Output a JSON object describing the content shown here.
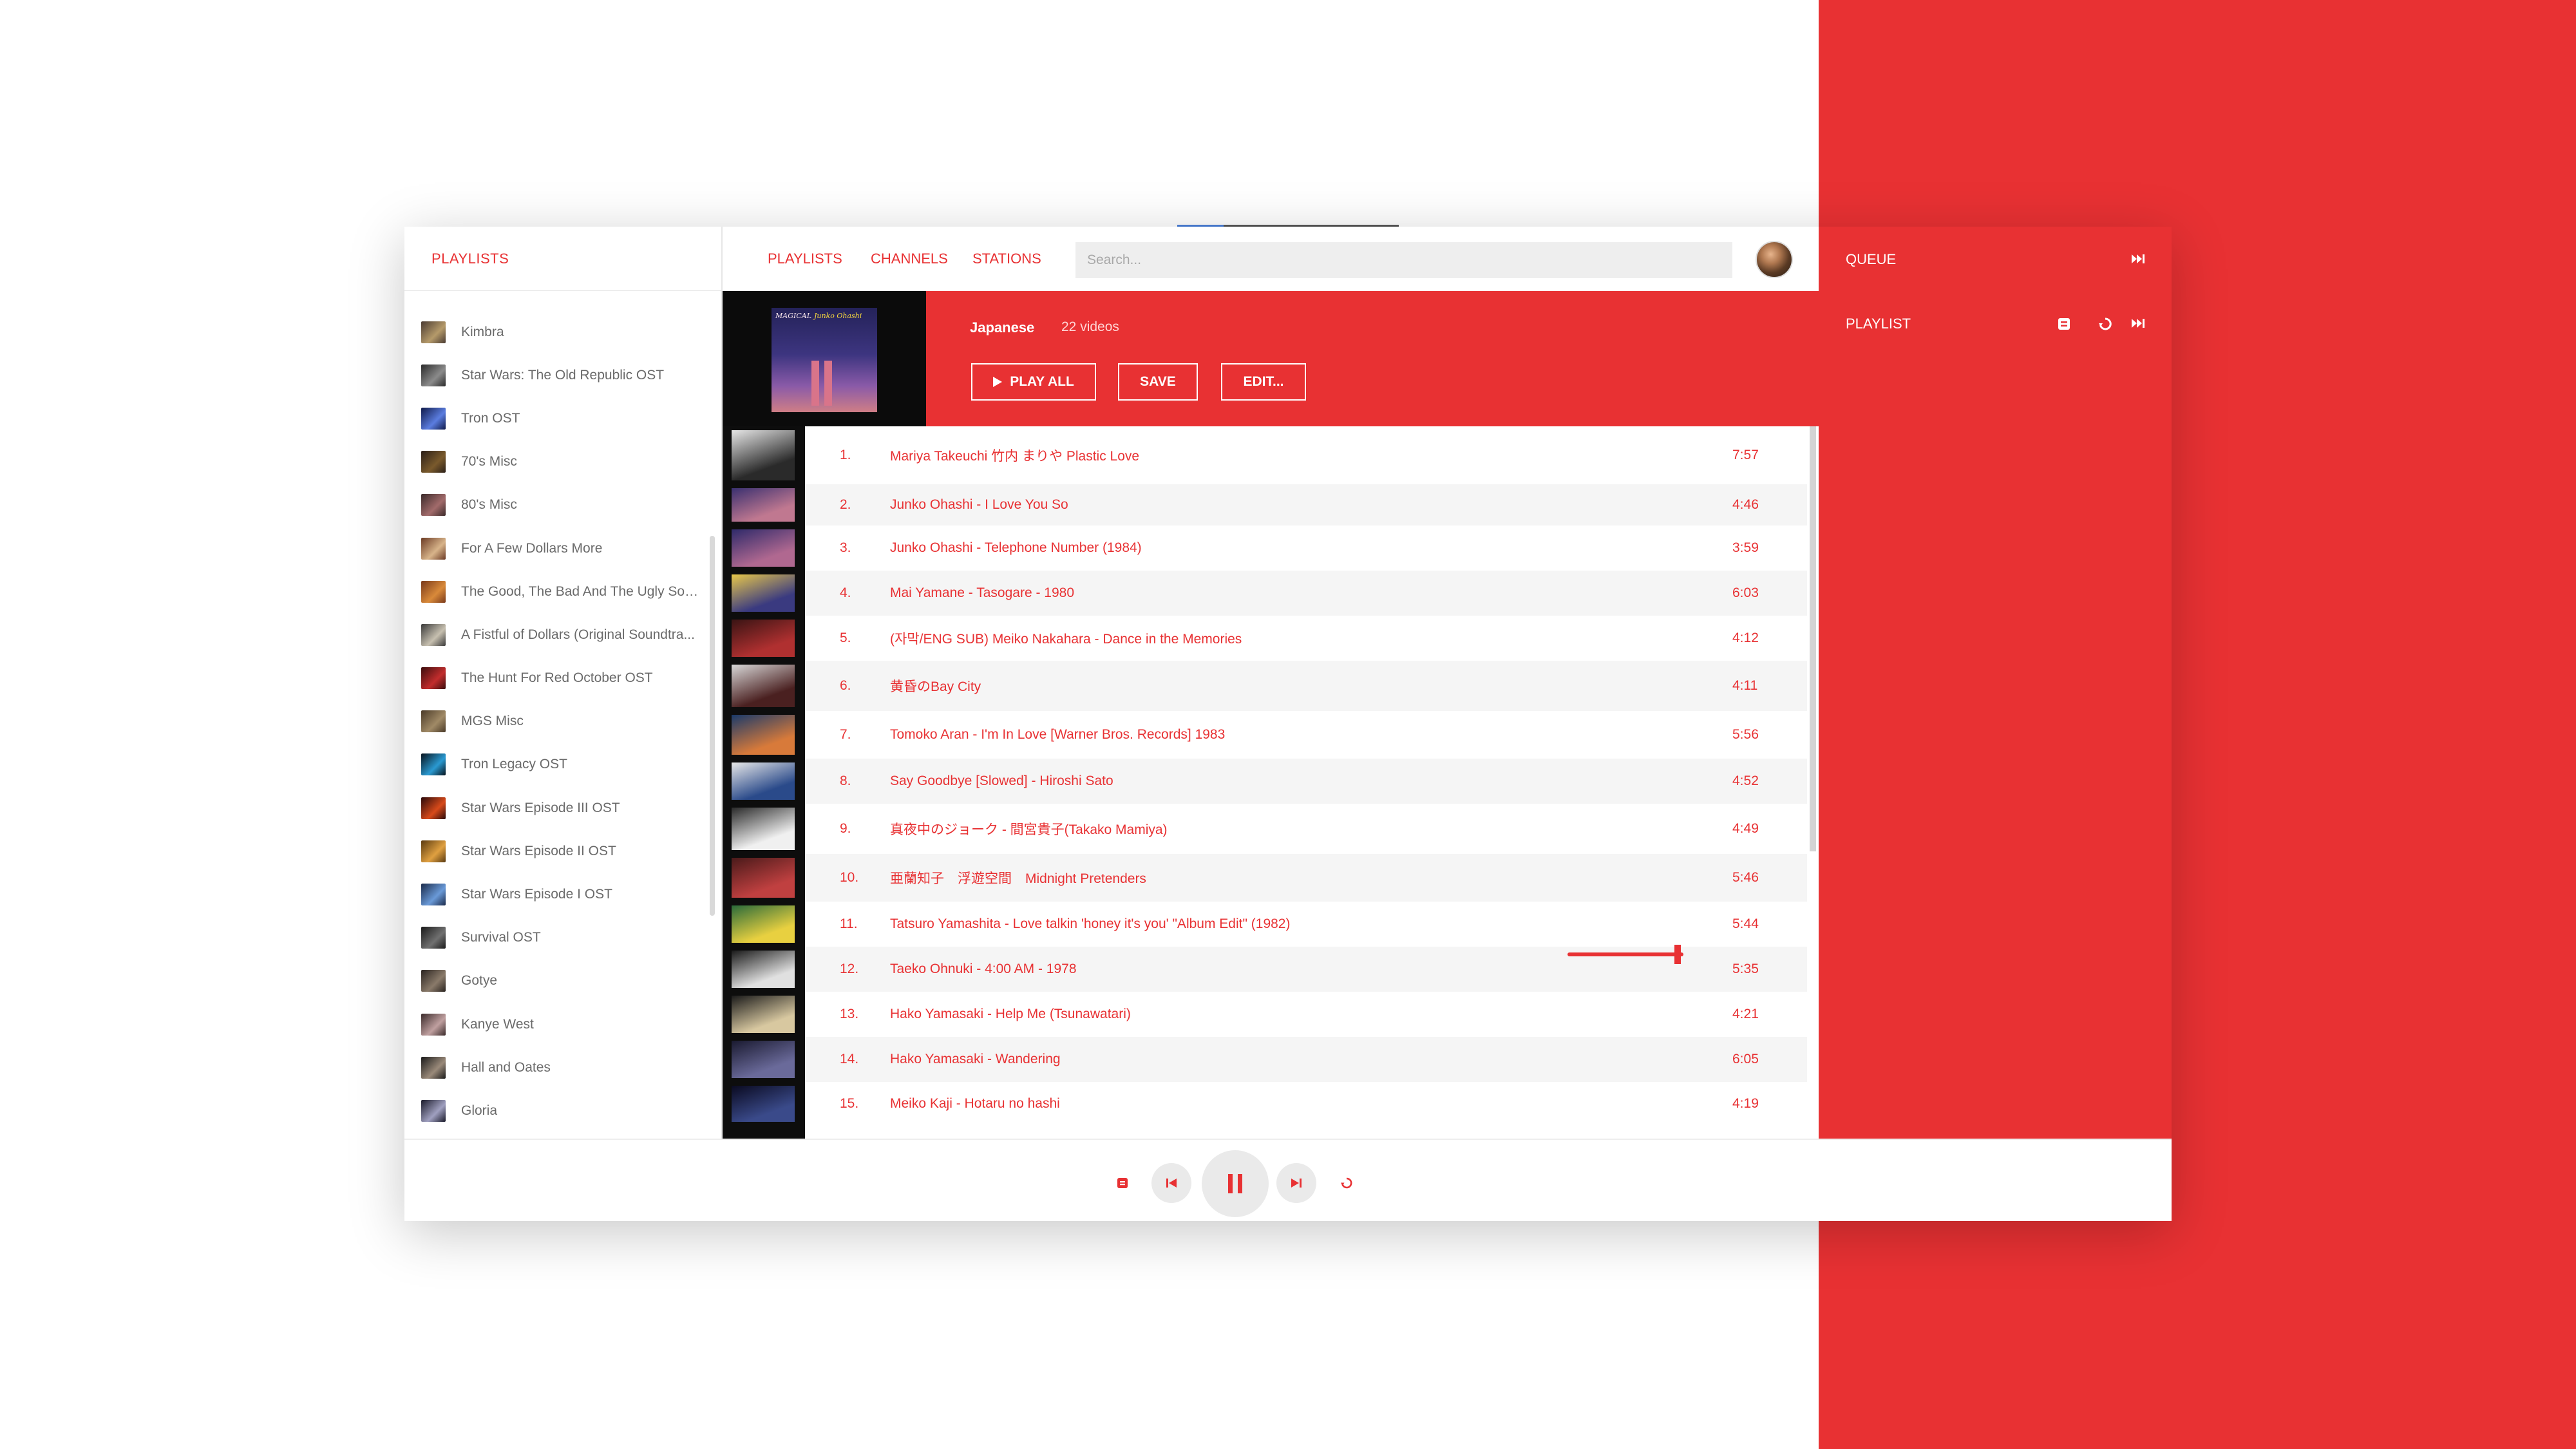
{
  "sidebar": {
    "heading": "PLAYLISTS",
    "items": [
      {
        "label": "Kimbra",
        "thumb": [
          "#4a3b32",
          "#b59a6a"
        ]
      },
      {
        "label": "Star Wars: The Old Republic OST",
        "thumb": [
          "#2a2a2a",
          "#8b8b8b"
        ]
      },
      {
        "label": "Tron OST",
        "thumb": [
          "#0f1a4a",
          "#5b7de0"
        ]
      },
      {
        "label": "70's Misc",
        "thumb": [
          "#2b1f18",
          "#7a5a2c"
        ]
      },
      {
        "label": "80's Misc",
        "thumb": [
          "#3b2a2a",
          "#a26b6b"
        ]
      },
      {
        "label": "For A Few Dollars More",
        "thumb": [
          "#6b3a24",
          "#d8b48a"
        ]
      },
      {
        "label": "The Good, The Bad And The Ugly Sou...",
        "thumb": [
          "#7a3a1a",
          "#d98a3a"
        ]
      },
      {
        "label": "A Fistful of Dollars (Original Soundtra...",
        "thumb": [
          "#3a3a3a",
          "#c7c0b0"
        ]
      },
      {
        "label": "The Hunt For Red October OST",
        "thumb": [
          "#3b0d0d",
          "#c22d2d"
        ]
      },
      {
        "label": "MGS Misc",
        "thumb": [
          "#4a3a28",
          "#a08a66"
        ]
      },
      {
        "label": "Tron Legacy OST",
        "thumb": [
          "#06121c",
          "#2a9ad2"
        ]
      },
      {
        "label": "Star Wars Episode III OST",
        "thumb": [
          "#2a0a0a",
          "#d84a1a"
        ]
      },
      {
        "label": "Star Wars Episode II OST",
        "thumb": [
          "#5a3a10",
          "#e0a040"
        ]
      },
      {
        "label": "Star Wars Episode I OST",
        "thumb": [
          "#1a2a4a",
          "#6a9ad8"
        ]
      },
      {
        "label": "Survival OST",
        "thumb": [
          "#1a1a1a",
          "#707070"
        ]
      },
      {
        "label": "Gotye",
        "thumb": [
          "#2a2420",
          "#8a7a6a"
        ]
      },
      {
        "label": "Kanye West",
        "thumb": [
          "#3a2a2a",
          "#c0a0a0"
        ]
      },
      {
        "label": "Hall and Oates",
        "thumb": [
          "#1a1a1a",
          "#9a8a7a"
        ]
      },
      {
        "label": "Gloria",
        "thumb": [
          "#1a1a2a",
          "#a0a0c0"
        ]
      }
    ]
  },
  "nav": {
    "tabs": [
      "PLAYLISTS",
      "CHANNELS",
      "STATIONS"
    ],
    "search_placeholder": "Search..."
  },
  "banner": {
    "playlist_name": "Japanese",
    "count": "22 videos",
    "cover_title": "MAGICAL",
    "cover_artist": "Junko Ohashi",
    "buttons": {
      "play_all": "PLAY ALL",
      "save": "SAVE",
      "edit": "EDIT..."
    }
  },
  "tracks": [
    {
      "num": "1.",
      "title": "Mariya Takeuchi 竹内 まりや Plastic Love",
      "duration": "7:57"
    },
    {
      "num": "2.",
      "title": "Junko Ohashi - I Love You So",
      "duration": "4:46"
    },
    {
      "num": "3.",
      "title": "Junko Ohashi - Telephone Number (1984)",
      "duration": "3:59"
    },
    {
      "num": "4.",
      "title": "Mai Yamane - Tasogare - 1980",
      "duration": "6:03"
    },
    {
      "num": "5.",
      "title": "(자막/ENG SUB) Meiko Nakahara - Dance in the Memories",
      "duration": "4:12"
    },
    {
      "num": "6.",
      "title": "黄昏のBay City",
      "duration": "4:11"
    },
    {
      "num": "7.",
      "title": "Tomoko Aran - I'm In Love [Warner Bros. Records] 1983",
      "duration": "5:56"
    },
    {
      "num": "8.",
      "title": "Say Goodbye [Slowed] - Hiroshi Sato",
      "duration": "4:52"
    },
    {
      "num": "9.",
      "title": "真夜中のジョーク - 間宮貴子(Takako Mamiya)",
      "duration": "4:49"
    },
    {
      "num": "10.",
      "title": "亜蘭知子　浮遊空間　Midnight Pretenders",
      "duration": "5:46"
    },
    {
      "num": "11.",
      "title": "Tatsuro Yamashita - Love talkin 'honey it's you' \"Album Edit\" (1982)",
      "duration": "5:44"
    },
    {
      "num": "12.",
      "title": "Taeko Ohnuki - 4:00 AM - 1978",
      "duration": "5:35"
    },
    {
      "num": "13.",
      "title": "Hako Yamasaki - Help Me (Tsunawatari)",
      "duration": "4:21"
    },
    {
      "num": "14.",
      "title": "Hako Yamasaki - Wandering",
      "duration": "6:05"
    },
    {
      "num": "15.",
      "title": "Meiko Kaji - Hotaru no hashi",
      "duration": "4:19"
    }
  ],
  "queue": {
    "heading": "QUEUE",
    "subheading": "PLAYLIST"
  },
  "player": {
    "state": "playing",
    "volume": 0.95
  },
  "colors": {
    "accent": "#e83133",
    "text_muted": "#6a6a6a",
    "row_alt": "#f5f5f5"
  }
}
